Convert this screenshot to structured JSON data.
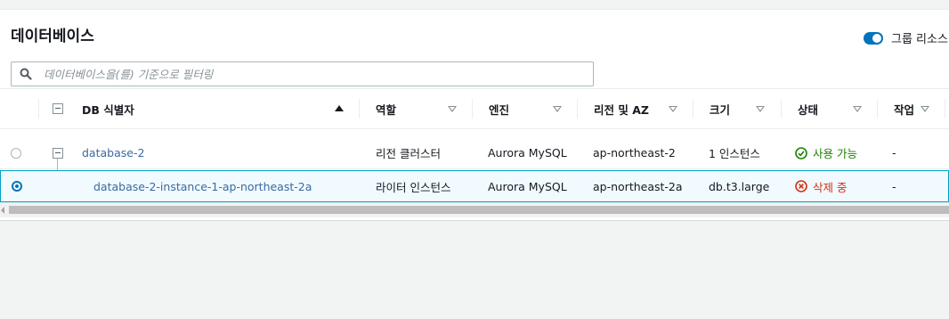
{
  "header": {
    "title": "데이터베이스",
    "group_toggle_label": "그룹 리소스"
  },
  "search": {
    "placeholder": "데이터베이스을(를) 기준으로 필터링"
  },
  "table": {
    "columns": [
      "DB 식별자",
      "역할",
      "엔진",
      "리전 및 AZ",
      "크기",
      "상태",
      "작업"
    ],
    "rows": [
      {
        "db_identifier": "database-2",
        "role": "리전 클러스터",
        "engine": "Aurora MySQL",
        "region_az": "ap-northeast-2",
        "size": "1 인스턴스",
        "status": "사용 가능",
        "action": "-",
        "selected": false
      },
      {
        "db_identifier": "database-2-instance-1-ap-northeast-2a",
        "role": "라이터 인스턴스",
        "engine": "Aurora MySQL",
        "region_az": "ap-northeast-2a",
        "size": "db.t3.large",
        "status": "삭제 중",
        "action": "-",
        "selected": true
      }
    ]
  },
  "colors": {
    "accent": "#0073bb",
    "link": "#3b6aa0",
    "status_available": "#1d8102",
    "status_deleting": "#d13212"
  },
  "icons": [
    "search-icon",
    "check-circle-icon",
    "x-circle-icon",
    "sort-ascending-icon",
    "filter-caret-icon",
    "expand-collapse-icon"
  ]
}
